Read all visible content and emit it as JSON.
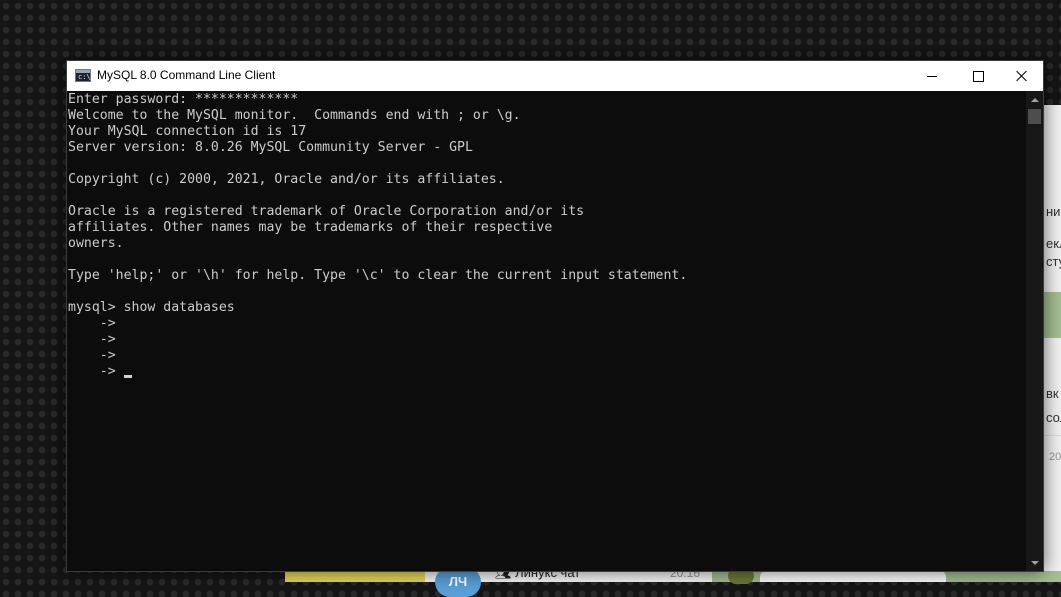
{
  "background_app": {
    "fragments": [
      "нин",
      "екл",
      "сту",
      "вк",
      "сол",
      "20"
    ],
    "bottom_chat": {
      "avatar_initials": "ЛЧ",
      "chat_name": "Линукс чат",
      "time": "20:16"
    }
  },
  "window": {
    "title": "MySQL 8.0 Command Line Client",
    "icon_glyph": "c:\\"
  },
  "console": {
    "lines": [
      "Enter password: *************",
      "Welcome to the MySQL monitor.  Commands end with ; or \\g.",
      "Your MySQL connection id is 17",
      "Server version: 8.0.26 MySQL Community Server - GPL",
      "",
      "Copyright (c) 2000, 2021, Oracle and/or its affiliates.",
      "",
      "Oracle is a registered trademark of Oracle Corporation and/or its",
      "affiliates. Other names may be trademarks of their respective",
      "owners.",
      "",
      "Type 'help;' or '\\h' for help. Type '\\c' to clear the current input statement.",
      "",
      "mysql> show databases",
      "    ->",
      "    ->",
      "    ->",
      "    ->"
    ]
  },
  "colors": {
    "console_bg": "#0c0c0c",
    "console_fg": "#cccccc",
    "titlebar_bg": "#ffffff"
  }
}
